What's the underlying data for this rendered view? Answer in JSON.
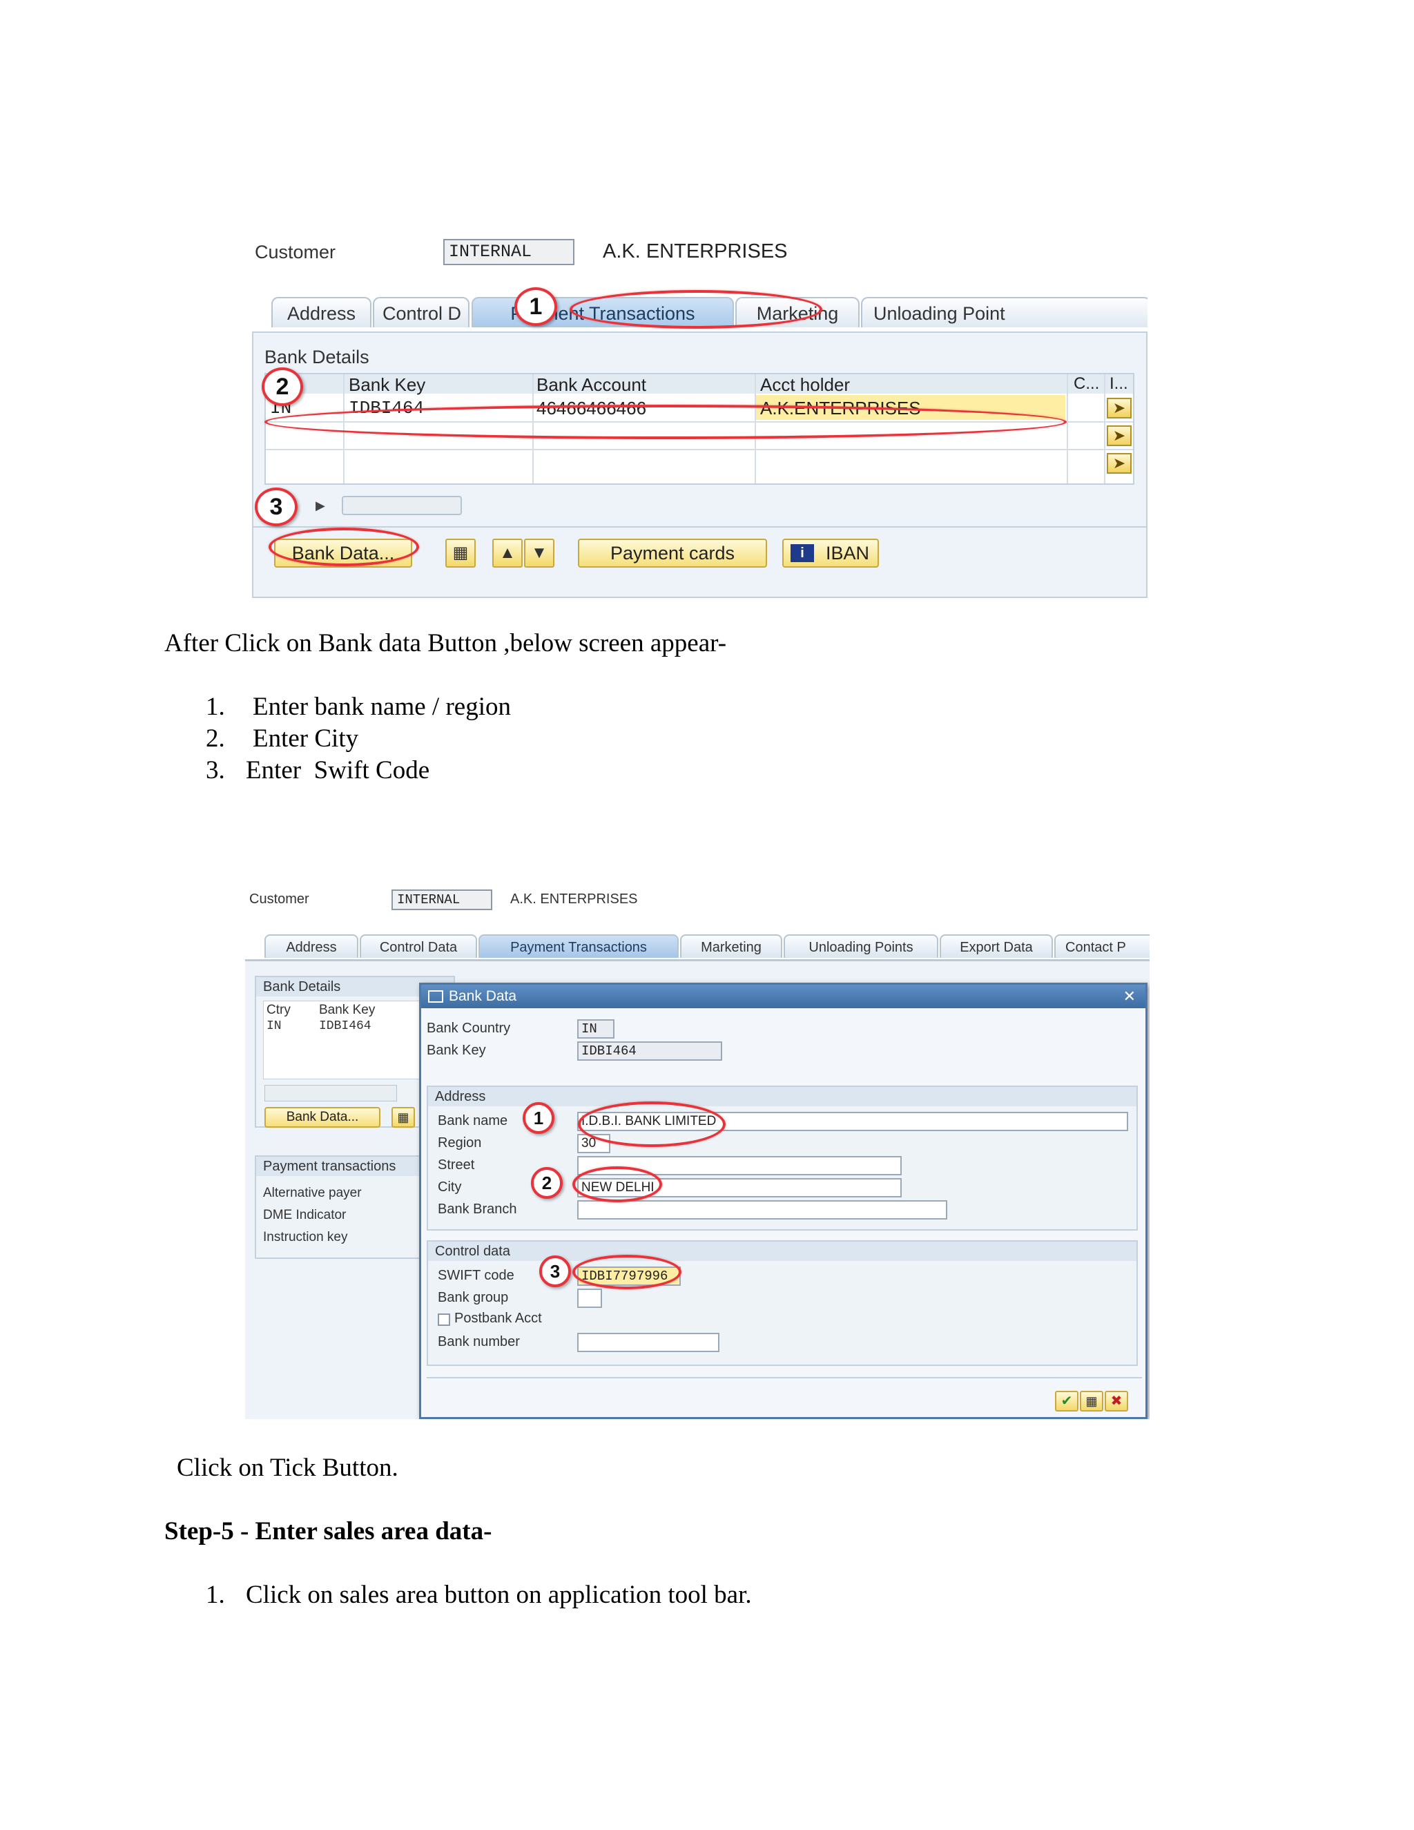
{
  "screen1": {
    "customer_label": "Customer",
    "customer_value": "INTERNAL",
    "customer_name": "A.K. ENTERPRISES",
    "tabs": [
      "Address",
      "Control D",
      "Payment Transactions",
      "Marketing",
      "Unloading Point"
    ],
    "section_title": "Bank Details",
    "columns": [
      "Bank Key",
      "Bank Account",
      "Acct holder",
      "C...",
      "I..."
    ],
    "row": {
      "ctry": "IN",
      "bank_key": "IDBI464",
      "bank_account": "46466466466",
      "acct_holder": "A.K.ENTERPRISES"
    },
    "buttons": {
      "bank_data": "Bank Data...",
      "payment_cards": "Payment cards",
      "iban": "IBAN"
    },
    "markers": [
      "1",
      "2",
      "3"
    ]
  },
  "doc": {
    "intro": "After Click on Bank data Button ,below screen appear-",
    "steps": [
      "Enter bank name / region",
      "Enter City",
      "Enter  Swift Code"
    ],
    "step_numbers": [
      "1.",
      "2.",
      "3."
    ],
    "click_tick": "Click on Tick Button.",
    "step5_heading": "Step-5 - Enter sales area data-",
    "step5_items": [
      "Click on sales area button on application tool bar."
    ],
    "step5_numbers": [
      "1."
    ]
  },
  "screen2": {
    "customer_label": "Customer",
    "customer_value": "INTERNAL",
    "customer_name": "A.K. ENTERPRISES",
    "tabs": [
      "Address",
      "Control Data",
      "Payment Transactions",
      "Marketing",
      "Unloading Points",
      "Export Data",
      "Contact P"
    ],
    "bank_details_title": "Bank Details",
    "bank_details_cols": [
      "Ctry",
      "Bank Key"
    ],
    "bank_details_row": [
      "IN",
      "IDBI464"
    ],
    "bank_data_button": "Bank Data...",
    "payment_section_title": "Payment transactions",
    "payment_fields": [
      "Alternative payer",
      "DME Indicator",
      "Instruction key"
    ],
    "dialog": {
      "title": "Bank Data",
      "bank_country_label": "Bank Country",
      "bank_country_value": "IN",
      "bank_key_label": "Bank Key",
      "bank_key_value": "IDBI464",
      "address_title": "Address",
      "bank_name_label": "Bank name",
      "bank_name_value": "I.D.B.I. BANK LIMITED",
      "region_label": "Region",
      "region_value": "30",
      "street_label": "Street",
      "city_label": "City",
      "city_value": "NEW DELHI",
      "bank_branch_label": "Bank Branch",
      "control_title": "Control data",
      "swift_label": "SWIFT code",
      "swift_value": "IDBI7797996",
      "bank_group_label": "Bank group",
      "postbank_label": "Postbank Acct",
      "bank_number_label": "Bank number"
    },
    "markers": [
      "1",
      "2",
      "3"
    ]
  }
}
